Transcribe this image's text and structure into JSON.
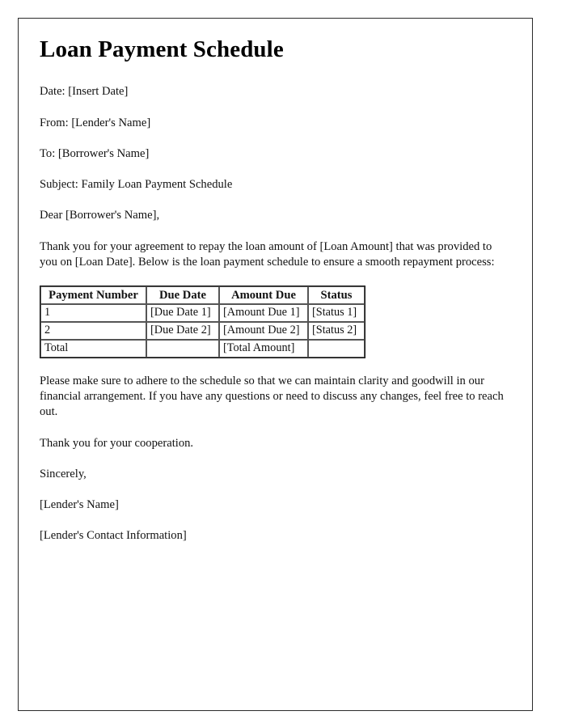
{
  "document": {
    "title": "Loan Payment Schedule",
    "fields": {
      "date_line": "Date: [Insert Date]",
      "from_line": "From: [Lender's Name]",
      "to_line": "To: [Borrower's Name]",
      "subject_line": "Subject: Family Loan Payment Schedule",
      "salutation": "Dear [Borrower's Name],"
    },
    "intro_paragraph": "Thank you for your agreement to repay the loan amount of [Loan Amount] that was provided to you on [Loan Date]. Below is the loan payment schedule to ensure a smooth repayment process:",
    "table": {
      "headers": [
        "Payment Number",
        "Due Date",
        "Amount Due",
        "Status"
      ],
      "rows": [
        [
          "1",
          "[Due Date 1]",
          "[Amount Due 1]",
          "[Status 1]"
        ],
        [
          "2",
          "[Due Date 2]",
          "[Amount Due 2]",
          "[Status 2]"
        ],
        [
          "Total",
          "",
          "[Total Amount]",
          ""
        ]
      ]
    },
    "closing_paragraph": "Please make sure to adhere to the schedule so that we can maintain clarity and goodwill in our financial arrangement. If you have any questions or need to discuss any changes, feel free to reach out.",
    "thanks_line": "Thank you for your cooperation.",
    "sign_off": "Sincerely,",
    "signature_name": "[Lender's Name]",
    "signature_contact": "[Lender's Contact Information]"
  },
  "colors": {
    "page_background": "#ffffff",
    "frame_border": "#2b2b2b",
    "text": "#111111",
    "table_border": "#555555"
  }
}
